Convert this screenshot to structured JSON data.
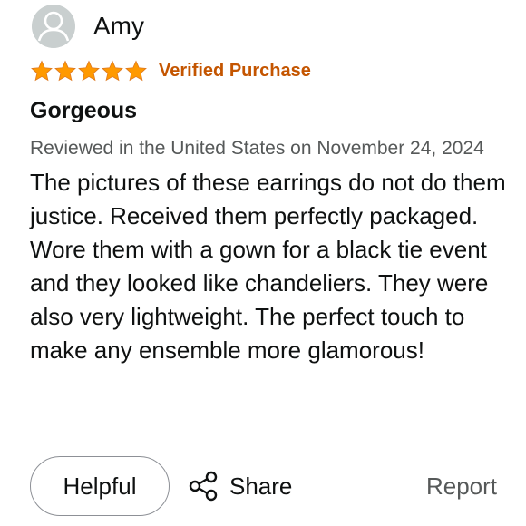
{
  "reviewer": {
    "name": "Amy",
    "avatar_icon": "person-silhouette-icon"
  },
  "rating": {
    "stars": 5,
    "max_stars": 5,
    "star_color": "#ff9900",
    "verified_label": "Verified Purchase",
    "verified_color": "#c45500"
  },
  "review": {
    "title": "Gorgeous",
    "date": "Reviewed in the United States on November 24, 2024",
    "body": "The pictures of these earrings do not do them justice. Received them perfectly packaged. Wore them with a gown for a black tie event and they looked like chandeliers. They were also very lightweight. The perfect touch to make any ensemble more glamorous!"
  },
  "actions": {
    "helpful_label": "Helpful",
    "share_label": "Share",
    "share_icon": "share-icon",
    "report_label": "Report"
  }
}
